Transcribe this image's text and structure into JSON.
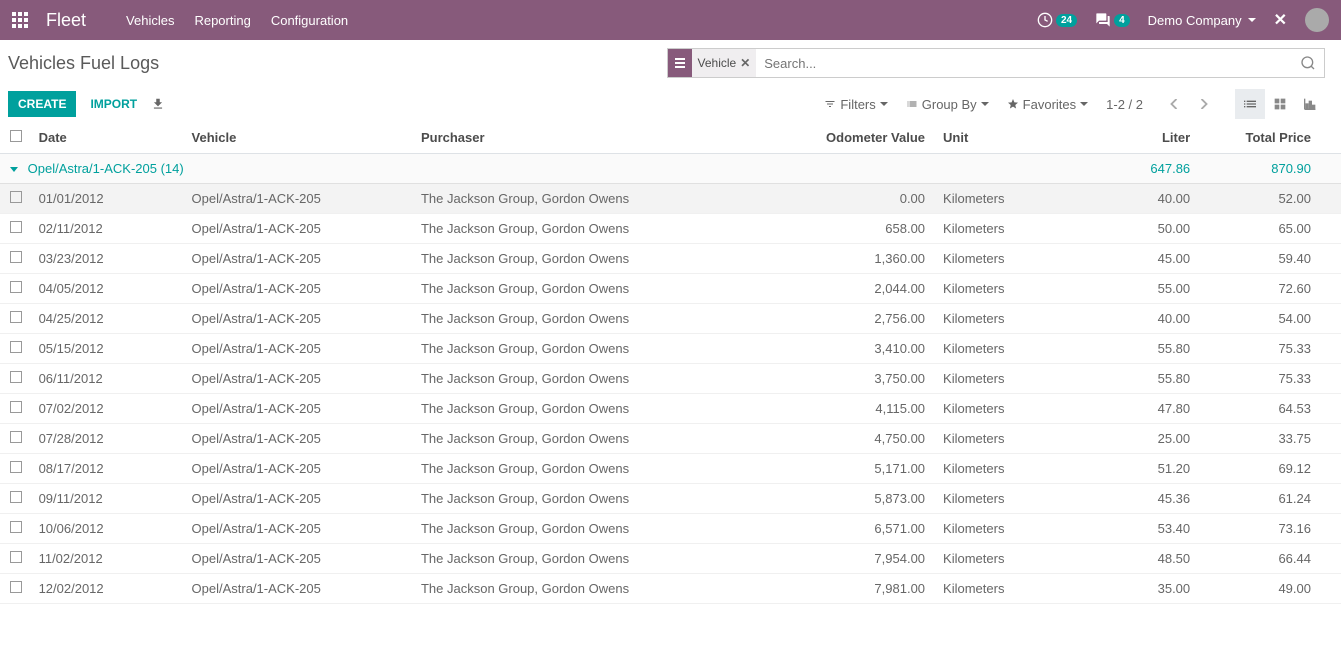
{
  "topbar": {
    "brand": "Fleet",
    "nav": [
      "Vehicles",
      "Reporting",
      "Configuration"
    ],
    "activity_count": "24",
    "chat_count": "4",
    "company": "Demo Company"
  },
  "panel": {
    "title": "Vehicles Fuel Logs",
    "search_facet": "Vehicle",
    "search_placeholder": "Search...",
    "create": "CREATE",
    "import": "IMPORT",
    "filters": "Filters",
    "groupby": "Group By",
    "favorites": "Favorites",
    "pager": "1-2 / 2"
  },
  "columns": {
    "date": "Date",
    "vehicle": "Vehicle",
    "purchaser": "Purchaser",
    "odometer": "Odometer Value",
    "unit": "Unit",
    "liter": "Liter",
    "total": "Total Price"
  },
  "group": {
    "label": "Opel/Astra/1-ACK-205 (14)",
    "liter_sum": "647.86",
    "total_sum": "870.90"
  },
  "rows": [
    {
      "date": "01/01/2012",
      "vehicle": "Opel/Astra/1-ACK-205",
      "purchaser": "The Jackson Group, Gordon Owens",
      "odometer": "0.00",
      "unit": "Kilometers",
      "liter": "40.00",
      "total": "52.00"
    },
    {
      "date": "02/11/2012",
      "vehicle": "Opel/Astra/1-ACK-205",
      "purchaser": "The Jackson Group, Gordon Owens",
      "odometer": "658.00",
      "unit": "Kilometers",
      "liter": "50.00",
      "total": "65.00"
    },
    {
      "date": "03/23/2012",
      "vehicle": "Opel/Astra/1-ACK-205",
      "purchaser": "The Jackson Group, Gordon Owens",
      "odometer": "1,360.00",
      "unit": "Kilometers",
      "liter": "45.00",
      "total": "59.40"
    },
    {
      "date": "04/05/2012",
      "vehicle": "Opel/Astra/1-ACK-205",
      "purchaser": "The Jackson Group, Gordon Owens",
      "odometer": "2,044.00",
      "unit": "Kilometers",
      "liter": "55.00",
      "total": "72.60"
    },
    {
      "date": "04/25/2012",
      "vehicle": "Opel/Astra/1-ACK-205",
      "purchaser": "The Jackson Group, Gordon Owens",
      "odometer": "2,756.00",
      "unit": "Kilometers",
      "liter": "40.00",
      "total": "54.00"
    },
    {
      "date": "05/15/2012",
      "vehicle": "Opel/Astra/1-ACK-205",
      "purchaser": "The Jackson Group, Gordon Owens",
      "odometer": "3,410.00",
      "unit": "Kilometers",
      "liter": "55.80",
      "total": "75.33"
    },
    {
      "date": "06/11/2012",
      "vehicle": "Opel/Astra/1-ACK-205",
      "purchaser": "The Jackson Group, Gordon Owens",
      "odometer": "3,750.00",
      "unit": "Kilometers",
      "liter": "55.80",
      "total": "75.33"
    },
    {
      "date": "07/02/2012",
      "vehicle": "Opel/Astra/1-ACK-205",
      "purchaser": "The Jackson Group, Gordon Owens",
      "odometer": "4,115.00",
      "unit": "Kilometers",
      "liter": "47.80",
      "total": "64.53"
    },
    {
      "date": "07/28/2012",
      "vehicle": "Opel/Astra/1-ACK-205",
      "purchaser": "The Jackson Group, Gordon Owens",
      "odometer": "4,750.00",
      "unit": "Kilometers",
      "liter": "25.00",
      "total": "33.75"
    },
    {
      "date": "08/17/2012",
      "vehicle": "Opel/Astra/1-ACK-205",
      "purchaser": "The Jackson Group, Gordon Owens",
      "odometer": "5,171.00",
      "unit": "Kilometers",
      "liter": "51.20",
      "total": "69.12"
    },
    {
      "date": "09/11/2012",
      "vehicle": "Opel/Astra/1-ACK-205",
      "purchaser": "The Jackson Group, Gordon Owens",
      "odometer": "5,873.00",
      "unit": "Kilometers",
      "liter": "45.36",
      "total": "61.24"
    },
    {
      "date": "10/06/2012",
      "vehicle": "Opel/Astra/1-ACK-205",
      "purchaser": "The Jackson Group, Gordon Owens",
      "odometer": "6,571.00",
      "unit": "Kilometers",
      "liter": "53.40",
      "total": "73.16"
    },
    {
      "date": "11/02/2012",
      "vehicle": "Opel/Astra/1-ACK-205",
      "purchaser": "The Jackson Group, Gordon Owens",
      "odometer": "7,954.00",
      "unit": "Kilometers",
      "liter": "48.50",
      "total": "66.44"
    },
    {
      "date": "12/02/2012",
      "vehicle": "Opel/Astra/1-ACK-205",
      "purchaser": "The Jackson Group, Gordon Owens",
      "odometer": "7,981.00",
      "unit": "Kilometers",
      "liter": "35.00",
      "total": "49.00"
    }
  ]
}
